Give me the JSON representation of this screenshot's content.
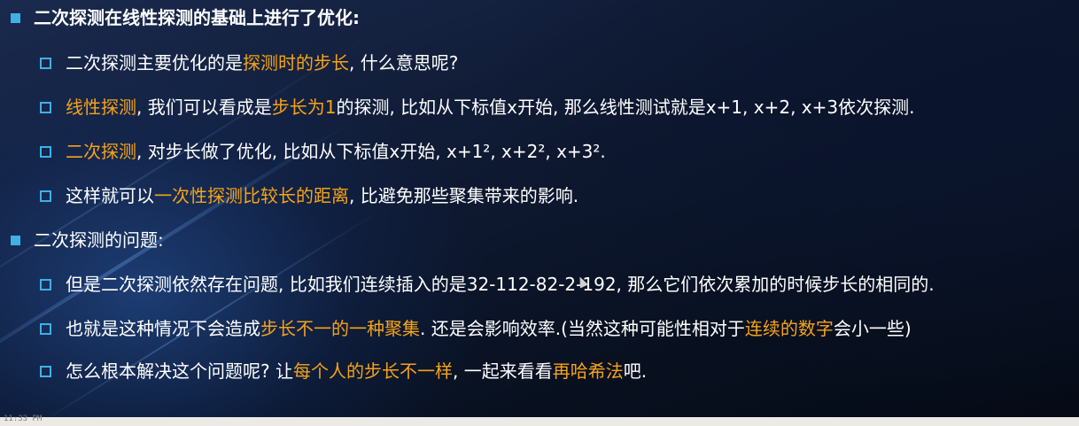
{
  "slide": {
    "items": [
      {
        "level": 1,
        "parts": [
          {
            "text": "二次探测在线性探测的基础上进行了优化:",
            "hl": false
          }
        ]
      },
      {
        "level": 2,
        "parts": [
          {
            "text": "二次探测主要优化的是",
            "hl": false
          },
          {
            "text": "探测时的步长",
            "hl": true
          },
          {
            "text": ", 什么意思呢?",
            "hl": false
          }
        ]
      },
      {
        "level": 2,
        "parts": [
          {
            "text": "线性探测",
            "hl": true
          },
          {
            "text": ", 我们可以看成是",
            "hl": false
          },
          {
            "text": "步长为1",
            "hl": true
          },
          {
            "text": "的探测, 比如从下标值x开始, 那么线性测试就是x+1, x+2, x+3依次探测.",
            "hl": false
          }
        ]
      },
      {
        "level": 2,
        "parts": [
          {
            "text": "二次探测",
            "hl": true
          },
          {
            "text": ", 对步长做了优化, 比如从下标值x开始, x+1², x+2², x+3².",
            "hl": false
          }
        ]
      },
      {
        "level": 2,
        "parts": [
          {
            "text": "这样就可以",
            "hl": false
          },
          {
            "text": "一次性探测比较长的距离",
            "hl": true
          },
          {
            "text": ", 比避免那些聚集带来的影响.",
            "hl": false
          }
        ]
      },
      {
        "level": 1,
        "parts": [
          {
            "text": "二次探测的问题:",
            "hl": false
          }
        ]
      },
      {
        "level": 2,
        "parts": [
          {
            "text": "但是二次探测依然存在问题, 比如我们连续插入的是32-112-82-2-192, 那么它们依次累加的时候步长的相同的.",
            "hl": false
          }
        ]
      },
      {
        "level": 2,
        "parts": [
          {
            "text": "也就是这种情况下会造成",
            "hl": false
          },
          {
            "text": "步长不一的一种聚集",
            "hl": true
          },
          {
            "text": ". 还是会影响效率.(当然这种可能性相对于",
            "hl": false
          },
          {
            "text": "连续的数字",
            "hl": true
          },
          {
            "text": "会小一些)",
            "hl": false
          }
        ]
      },
      {
        "level": 2,
        "parts": [
          {
            "text": "怎么根本解决这个问题呢? 让",
            "hl": false
          },
          {
            "text": "每个人的步长不一样",
            "hl": true
          },
          {
            "text": ", 一起来看看",
            "hl": false
          },
          {
            "text": "再哈希法",
            "hl": true
          },
          {
            "text": "吧.",
            "hl": false
          }
        ]
      }
    ],
    "colors": {
      "text": "#ffffff",
      "highlight": "#f6a317",
      "bullet": "#3fb0e8",
      "background": "#0f1a33"
    }
  },
  "bottom_strip": {
    "text": "11:33 PM"
  }
}
